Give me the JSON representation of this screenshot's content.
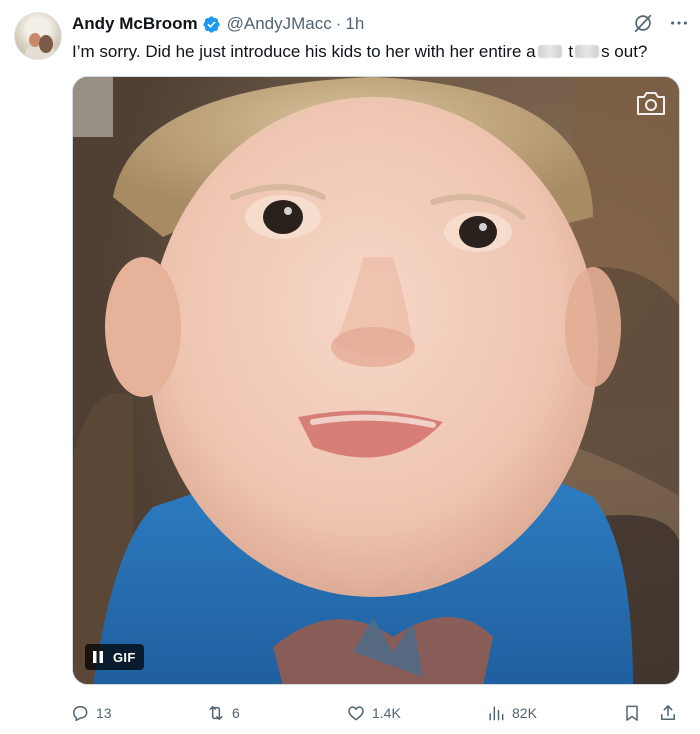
{
  "author": {
    "name": "Andy McBroom",
    "handle": "@AndyJMacc",
    "separator": "·",
    "time": "1h",
    "verified": true
  },
  "tweet": {
    "text_before": "I’m sorry. Did he just introduce his kids to her with her entire a",
    "text_middle": " t",
    "text_after": "s out?"
  },
  "media": {
    "type": "GIF",
    "badge_label": "GIF",
    "playing": true
  },
  "actions": {
    "replies": "13",
    "reposts": "6",
    "likes": "1.4K",
    "views": "82K"
  },
  "colors": {
    "text": "#0f1419",
    "secondary": "#536471",
    "verified_blue": "#1d9bf0",
    "border": "#cfd9de"
  },
  "icons": [
    "verified-badge-icon",
    "grok-icon",
    "more-icon",
    "camera-icon",
    "pause-icon",
    "reply-icon",
    "repost-icon",
    "like-icon",
    "views-icon",
    "bookmark-icon",
    "share-icon"
  ]
}
